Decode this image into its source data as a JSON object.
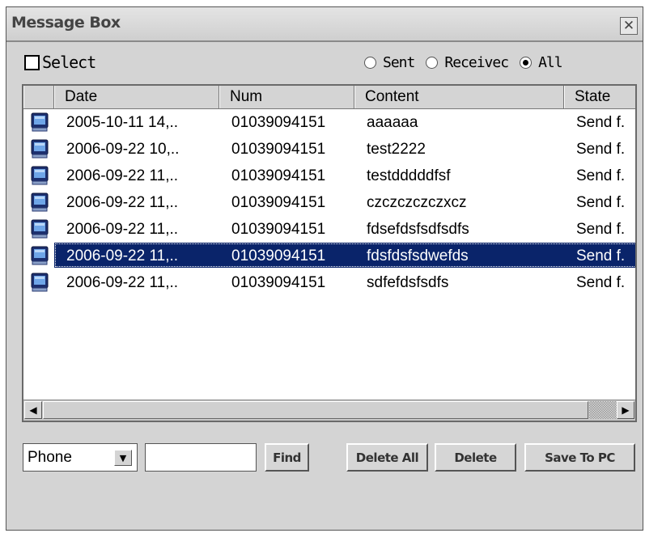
{
  "window": {
    "title": "Message Box",
    "close_icon": "close-x-icon"
  },
  "filter": {
    "select_label": "Select",
    "select_checked": false,
    "radios": [
      {
        "label": "Sent",
        "checked": false
      },
      {
        "label": "Receivec",
        "checked": false
      },
      {
        "label": "All",
        "checked": true
      }
    ]
  },
  "table": {
    "columns": [
      "Date",
      "Num",
      "Content",
      "State"
    ],
    "rows": [
      {
        "date": "2005-10-11 14,..",
        "num": "01039094151",
        "content": "aaaaaa",
        "state": "Send f.",
        "selected": false
      },
      {
        "date": "2006-09-22 10,..",
        "num": "01039094151",
        "content": "test2222",
        "state": "Send f.",
        "selected": false
      },
      {
        "date": "2006-09-22 11,..",
        "num": "01039094151",
        "content": "testdddddfsf",
        "state": "Send f.",
        "selected": false
      },
      {
        "date": "2006-09-22 11,..",
        "num": "01039094151",
        "content": "czczczczczxcz",
        "state": "Send f.",
        "selected": false
      },
      {
        "date": "2006-09-22 11,..",
        "num": "01039094151",
        "content": "fdsefdsfsdfsdfs",
        "state": "Send f.",
        "selected": false
      },
      {
        "date": "2006-09-22 11,..",
        "num": "01039094151",
        "content": "fdsfdsfsdwefds",
        "state": "Send f.",
        "selected": true
      },
      {
        "date": "2006-09-22 11,..",
        "num": "01039094151",
        "content": "sdfefdsfsdfs",
        "state": "Send f.",
        "selected": false
      }
    ],
    "row_icon": "phone-device-icon"
  },
  "search": {
    "field_value": "Phone",
    "query": ""
  },
  "buttons": {
    "find": "Find",
    "delete_all": "Delete All",
    "delete": "Delete",
    "save": "Save To PC"
  },
  "colors": {
    "selection": "#0a246a",
    "window_bg": "#d4d4d4"
  }
}
